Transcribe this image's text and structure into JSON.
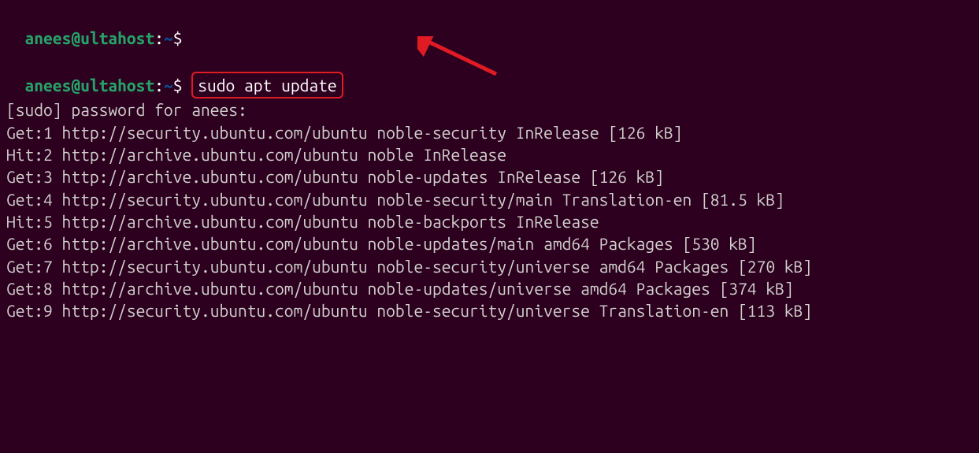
{
  "prompt1": {
    "user_host": "anees@ultahost",
    "separator": ":",
    "path": "~",
    "dollar": "$"
  },
  "prompt2": {
    "user_host": "anees@ultahost",
    "separator": ":",
    "path": "~",
    "dollar": "$",
    "command": "sudo apt update"
  },
  "annotation": {
    "arrow_color": "#e01b24",
    "arrow_direction": "down-left"
  },
  "output": {
    "l0": "[sudo] password for anees:",
    "l1": "Get:1 http://security.ubuntu.com/ubuntu noble-security InRelease [126 kB]",
    "l2": "Hit:2 http://archive.ubuntu.com/ubuntu noble InRelease",
    "l3": "Get:3 http://archive.ubuntu.com/ubuntu noble-updates InRelease [126 kB]",
    "l4": "Get:4 http://security.ubuntu.com/ubuntu noble-security/main Translation-en [81.5 kB]",
    "l5": "Hit:5 http://archive.ubuntu.com/ubuntu noble-backports InRelease",
    "l6": "Get:6 http://archive.ubuntu.com/ubuntu noble-updates/main amd64 Packages [530 kB]",
    "l7": "Get:7 http://security.ubuntu.com/ubuntu noble-security/universe amd64 Packages [270 kB]",
    "l8": "Get:8 http://archive.ubuntu.com/ubuntu noble-updates/universe amd64 Packages [374 kB]",
    "l9": "Get:9 http://security.ubuntu.com/ubuntu noble-security/universe Translation-en [113 kB]"
  }
}
